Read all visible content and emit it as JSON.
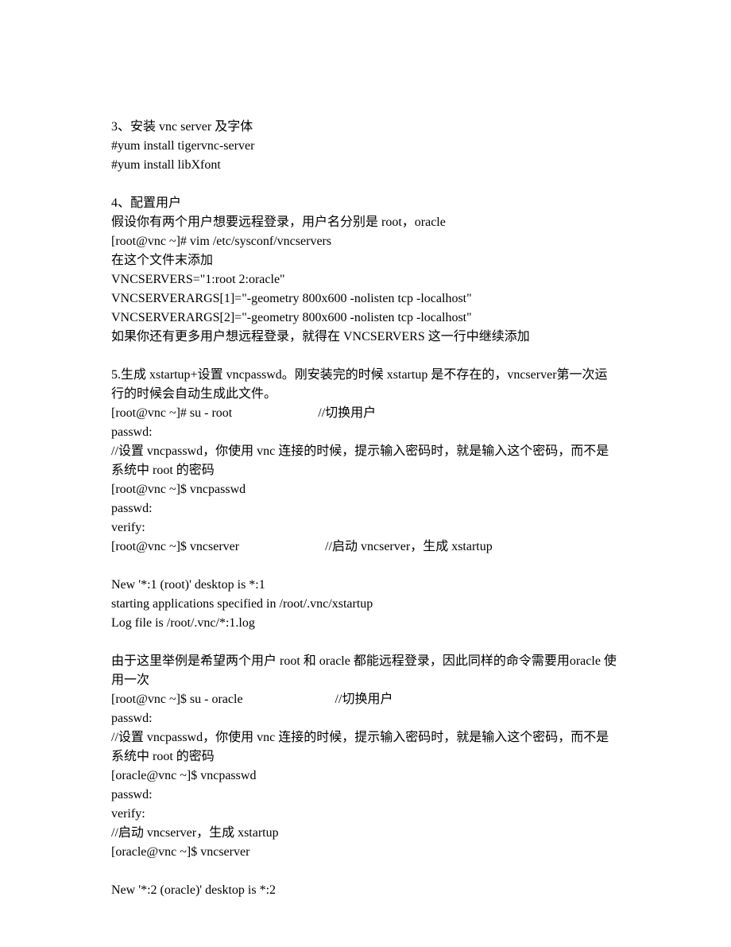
{
  "lines": [
    "3、安装 vnc server 及字体",
    "#yum install tigervnc-server",
    "#yum install libXfont",
    "",
    "4、配置用户",
    "假设你有两个用户想要远程登录，用户名分别是 root，oracle",
    "[root@vnc ~]# vim /etc/sysconf/vncservers",
    "在这个文件末添加",
    "VNCSERVERS=\"1:root 2:oracle\"",
    "VNCSERVERARGS[1]=\"-geometry 800x600 -nolisten tcp -localhost\"",
    "VNCSERVERARGS[2]=\"-geometry 800x600 -nolisten tcp -localhost\"",
    "如果你还有更多用户想远程登录，就得在 VNCSERVERS 这一行中继续添加",
    "",
    "5.生成 xstartup+设置 vncpasswd。刚安装完的时候 xstartup 是不存在的，vncserver第一次运行的时候会自动生成此文件。",
    "[root@vnc ~]# su - root                           //切换用户",
    "passwd:",
    "//设置 vncpasswd，你使用 vnc 连接的时候，提示输入密码时，就是输入这个密码，而不是系统中 root 的密码",
    "[root@vnc ~]$ vncpasswd",
    "passwd:",
    "verify:",
    "[root@vnc ~]$ vncserver                           //启动 vncserver，生成 xstartup",
    "",
    "New '*:1 (root)' desktop is *:1",
    "starting applications specified in /root/.vnc/xstartup",
    "Log file is /root/.vnc/*:1.log",
    "",
    "由于这里举例是希望两个用户 root 和 oracle 都能远程登录，因此同样的命令需要用oracle 使用一次",
    "[root@vnc ~]$ su - oracle                             //切换用户",
    "passwd:",
    "//设置 vncpasswd，你使用 vnc 连接的时候，提示输入密码时，就是输入这个密码，而不是系统中 root 的密码",
    "[oracle@vnc ~]$ vncpasswd",
    "passwd:",
    "verify:",
    "//启动 vncserver，生成 xstartup",
    "[oracle@vnc ~]$ vncserver",
    "",
    "New '*:2 (oracle)' desktop is *:2"
  ]
}
